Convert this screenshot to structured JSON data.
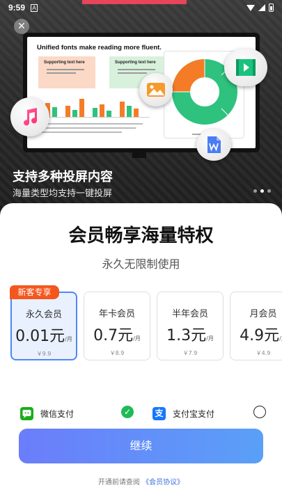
{
  "status_bar": {
    "time": "9:59",
    "notification": "A"
  },
  "hero": {
    "slide_title": "Unified fonts make reading more fluent.",
    "card_a_title": "Supporting text here",
    "card_b_title": "Supporting text here",
    "title": "支持多种投屏内容",
    "subtitle": "海量类型均支持一键投屏",
    "close_icon": "close-icon",
    "bubble_icons": [
      "music-icon",
      "image-icon",
      "video-icon",
      "document-icon"
    ],
    "carousel": {
      "count": 3,
      "active_index": 1
    }
  },
  "sheet": {
    "title": "会员畅享海量特权",
    "subtitle": "永久无限制使用"
  },
  "plans": [
    {
      "badge": "新客专享",
      "name": "永久会员",
      "price": "0.01元",
      "unit": "/月",
      "original": "￥9.9",
      "selected": true
    },
    {
      "name": "年卡会员",
      "price": "0.7元",
      "unit": "/月",
      "original": "￥8.9",
      "selected": false
    },
    {
      "name": "半年会员",
      "price": "1.3元",
      "unit": "/月",
      "original": "￥7.9",
      "selected": false
    },
    {
      "name": "月会员",
      "price": "4.9元",
      "unit": "/月",
      "original": "￥4.9",
      "selected": false
    }
  ],
  "payment": {
    "wechat_label": "微信支付",
    "alipay_label": "支付宝支付",
    "alipay_glyph": "支",
    "selected": "wechat"
  },
  "continue_label": "继续",
  "agreement": {
    "prefix": "开通前请查阅",
    "link": "《会员协议》"
  },
  "colors": {
    "accent_blue": "#4e87f5",
    "badge_orange": "#f4571e",
    "wechat_green": "#1aad19",
    "alipay_blue": "#1677ff",
    "button_gradient_start": "#6b7dfb",
    "button_gradient_end": "#5aa0f7"
  }
}
